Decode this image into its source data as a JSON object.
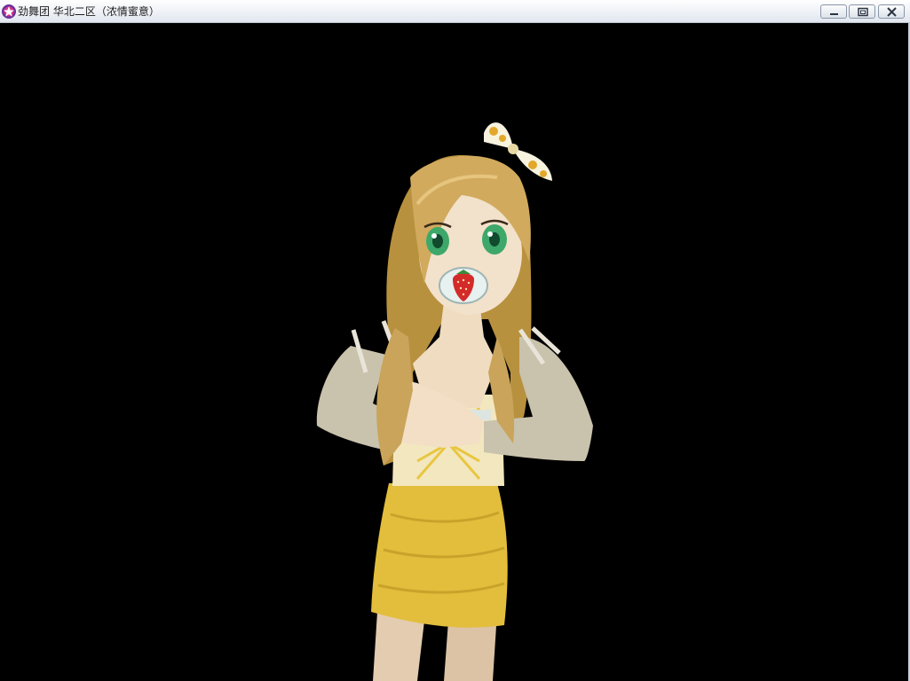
{
  "window": {
    "title": "劲舞团 华北二区（浓情蜜意）",
    "icon": "jinwutuan-app-icon",
    "controls": [
      {
        "icon": "minimize-icon"
      },
      {
        "icon": "restore-icon"
      },
      {
        "icon": "close-icon"
      }
    ]
  },
  "scene": {
    "background_color": "#000000",
    "character": {
      "description_icon": "dancer-avatar",
      "hair_color": "#c9a45a",
      "skirt_color": "#e8c640",
      "sleeve_color": "#c9c2ad",
      "eye_color": "#3da86a",
      "accessory": "strawberry-pacifier",
      "headwear": "polka-dot-bow"
    }
  }
}
